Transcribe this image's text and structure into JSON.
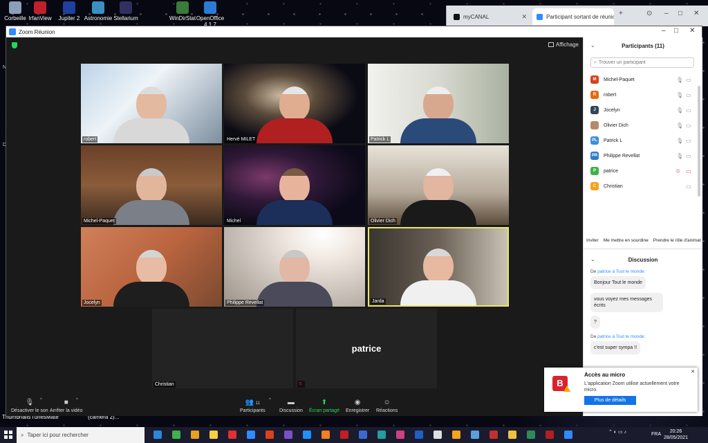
{
  "desktop": {
    "icons": [
      {
        "label": "Corbeille",
        "color": "#8aa0b8"
      },
      {
        "label": "IrfanView",
        "color": "#c0202a"
      },
      {
        "label": "Jupiter 2",
        "color": "#2040a0"
      },
      {
        "label": "Astronomie",
        "color": "#3a90c0"
      },
      {
        "label": "Stellarium",
        "color": "#303060"
      },
      {
        "label": "WinDirStat",
        "color": "#3a7a3a"
      },
      {
        "label": "OpenOffice 4.1.7",
        "color": "#2b7bd6"
      }
    ],
    "bottom_labels": [
      "Thumbnails",
      "TunesMate",
      "(camera 2)..."
    ]
  },
  "browser": {
    "tabs": [
      {
        "label": "myCANAL",
        "fav_color": "#111111"
      },
      {
        "label": "Participant sortant de réunion",
        "fav_color": "#2d8cff"
      }
    ]
  },
  "zoom": {
    "window_title": "Zoom Réunion",
    "view_label": "Affichage",
    "tiles": [
      {
        "name": "robert",
        "bg": "linear-gradient(135deg,#bcd3e8,#eef4f8 40%,#7c8fa0)",
        "skin": "#e3b9a0",
        "shirt": "#d8d8d8",
        "hair": "#dcdcdc"
      },
      {
        "name": "Hervé MILET",
        "bg": "radial-gradient(ellipse at 40% 40%,#c9b8a0 0,#5a4a3a 30%,#0b0b15 65%)",
        "skin": "#e0ad90",
        "shirt": "#b02020",
        "hair": "#e6e6e6"
      },
      {
        "name": "Patrick L",
        "bg": "linear-gradient(90deg,#f2f2ee,#d8d9d0 50%,#a9b1a0)",
        "skin": "#d8a88e",
        "shirt": "#2a4a7a",
        "hair": "#eeeeee"
      },
      {
        "name": "Michel-Paquet",
        "bg": "linear-gradient(180deg,#6a4028,#8a5c3a 50%,#3b2a20)",
        "skin": "#e2b69a",
        "shirt": "#7a7f88",
        "hair": "#c9c9c9"
      },
      {
        "name": "Michel",
        "bg": "radial-gradient(ellipse at 30% 40%,#7a3a6a 0,#301838 35%,#0c0a18 70%)",
        "skin": "#e7b39a",
        "shirt": "#1c2e5a",
        "hair": "#7a5a40"
      },
      {
        "name": "Olivier Dich",
        "bg": "linear-gradient(180deg,#e7e2d8,#b5a99a 60%,#5a4a3a)",
        "skin": "#e2b6a0",
        "shirt": "#1a1a1a",
        "hair": "#f0f0f0"
      },
      {
        "name": "Jocelyn",
        "bg": "linear-gradient(135deg,#d0805a,#b9643e 50%,#7a4a30)",
        "skin": "#e8bca4",
        "shirt": "#1e1e1e",
        "hair": "#d4d4d4"
      },
      {
        "name": "Philippe Revellat",
        "bg": "radial-gradient(ellipse at 70% 10%,#ffffff 0,#f0e8e0 25%,#c8c0b8 60%,#9a9088)",
        "skin": "#e2b8a5",
        "shirt": "#4a4a5a",
        "hair": "#c8c8c8"
      },
      {
        "name": "Jarda",
        "bg": "linear-gradient(90deg,#3a3530,#6a6055 50%,#c9c2b5)",
        "skin": "#e6b9a0",
        "shirt": "#f0f0f0",
        "hair": "#d8d8d8",
        "active": true
      },
      {
        "name": "Christian",
        "empty": true
      },
      {
        "name": "",
        "empty": true,
        "display_name": "patrice",
        "muted": true
      }
    ],
    "toolbar": {
      "mute": "Désactiver le son",
      "video": "Arrêter la vidéo",
      "participants": "Participants",
      "participants_count": "11",
      "chat": "Discussion",
      "share": "Écran partagé",
      "record": "Enregistrer",
      "reactions": "Réactions"
    },
    "panel": {
      "participants_title": "Participants (11)",
      "search_placeholder": "Trouver un participant",
      "participants": [
        {
          "name": "Michel-Paquet",
          "initials": "M",
          "color": "#d9411e",
          "mic": "on",
          "video": "on"
        },
        {
          "name": "robert",
          "initials": "R",
          "color": "#e8690c",
          "mic": "on",
          "video": "on"
        },
        {
          "name": "Jocelyn",
          "initials": "J",
          "color": "#334556",
          "mic": "on",
          "video": "on"
        },
        {
          "name": "Olivier Dich",
          "initials": "",
          "color": "#b88a6a",
          "mic": "on",
          "video": "on"
        },
        {
          "name": "Patrick L",
          "initials": "PL",
          "color": "#3b8fd9",
          "mic": "on",
          "video": "on"
        },
        {
          "name": "Philippe Revellat",
          "initials": "PR",
          "color": "#2f7cc8",
          "mic": "on",
          "video": "on"
        },
        {
          "name": "patrice",
          "initials": "P",
          "color": "#3fb24a",
          "mic": "off",
          "video": "off"
        },
        {
          "name": "Christian",
          "initials": "C",
          "color": "#f5a31a",
          "mic": "none",
          "video": "on"
        }
      ],
      "actions": [
        "Inviter",
        "Me mettre en sourdine",
        "Prendre le rôle d'animat"
      ],
      "chat_title": "Discussion",
      "messages": [
        {
          "from": "De",
          "sender": "patrice à Tout le monde:",
          "bubbles": [
            "Bonjour Tout le monde",
            "vous voyez mes messages écrits",
            "?"
          ]
        },
        {
          "from": "De",
          "sender": "patrice à Tout le monde:",
          "bubbles": [
            "c'est super sympa !!"
          ]
        }
      ]
    }
  },
  "notification": {
    "title": "Accès au micro",
    "body": "L'application Zoom utilise actuellement votre micro.",
    "button": "Plus de détails",
    "icon_letter": "B"
  },
  "taskbar": {
    "search_placeholder": "Taper ici pour rechercher",
    "lang": "FRA",
    "time": "20:26",
    "date": "28/05/2021",
    "apps": [
      "#2b88d8",
      "#3fb24a",
      "#e8a020",
      "#f5d040",
      "#e03030",
      "#2d8cff",
      "#d9411e",
      "#7a4fc8",
      "#1e90ff",
      "#f08020",
      "#c02020",
      "#3a6ad0",
      "#20a0a0",
      "#d04080",
      "#2060c0",
      "#e0e0e0",
      "#f5a31a",
      "#5aa0e0",
      "#c03030",
      "#f0c040",
      "#2e8b57",
      "#b02020",
      "#2d8cff"
    ]
  }
}
